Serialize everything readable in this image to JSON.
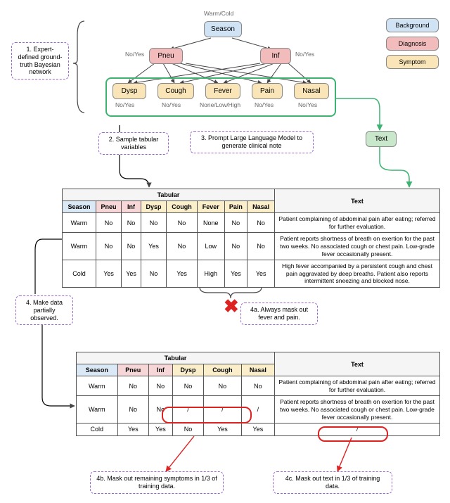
{
  "steps": {
    "s1": "1. Expert-defined ground-truth Bayesian network",
    "s2": "2. Sample tabular variables",
    "s3": "3. Prompt Large Language Model to generate clinical note",
    "s4": "4. Make data partially observed.",
    "s4a": "4a. Always mask out fever and pain.",
    "s4b": "4b. Mask out remaining symptoms in 1/3 of training data.",
    "s4c": "4c. Mask out text in 1/3 of training data."
  },
  "legend": {
    "background": "Background",
    "diagnosis": "Diagnosis",
    "symptom": "Symptom"
  },
  "network": {
    "season": "Season",
    "season_vals": "Warm/Cold",
    "pneu": "Pneu",
    "inf": "Inf",
    "diag_vals": "No/Yes",
    "dysp": "Dysp",
    "cough": "Cough",
    "fever": "Fever",
    "pain": "Pain",
    "nasal": "Nasal",
    "text": "Text",
    "symp_binary": "No/Yes",
    "fever_vals": "None/Low/High"
  },
  "table1": {
    "super_tab": "Tabular",
    "super_text": "Text",
    "headers": [
      "Season",
      "Pneu",
      "Inf",
      "Dysp",
      "Cough",
      "Fever",
      "Pain",
      "Nasal"
    ],
    "rows": [
      {
        "cells": [
          "Warm",
          "No",
          "No",
          "No",
          "No",
          "None",
          "No",
          "No"
        ],
        "text": "Patient complaining of abdominal pain after eating; referred for further evaluation."
      },
      {
        "cells": [
          "Warm",
          "No",
          "No",
          "Yes",
          "No",
          "Low",
          "No",
          "No"
        ],
        "text": "Patient reports shortness of breath on exertion for the past two weeks. No associated cough or chest pain. Low-grade fever occasionally present."
      },
      {
        "cells": [
          "Cold",
          "Yes",
          "Yes",
          "No",
          "Yes",
          "High",
          "Yes",
          "Yes"
        ],
        "text": "High fever accompanied by a persistent cough and chest pain aggravated by deep breaths. Patient also reports intermittent sneezing and blocked nose."
      }
    ]
  },
  "table2": {
    "super_tab": "Tabular",
    "super_text": "Text",
    "headers": [
      "Season",
      "Pneu",
      "Inf",
      "Dysp",
      "Cough",
      "Nasal"
    ],
    "rows": [
      {
        "cells": [
          "Warm",
          "No",
          "No",
          "No",
          "No",
          "No"
        ],
        "text": "Patient complaining of abdominal pain after eating; referred for further evaluation."
      },
      {
        "cells": [
          "Warm",
          "No",
          "No",
          "/",
          "/",
          "/"
        ],
        "text": "Patient reports shortness of breath on exertion for the past two weeks. No associated cough or chest pain. Low-grade fever occasionally present."
      },
      {
        "cells": [
          "Cold",
          "Yes",
          "Yes",
          "No",
          "Yes",
          "Yes"
        ],
        "text": "/"
      }
    ]
  }
}
